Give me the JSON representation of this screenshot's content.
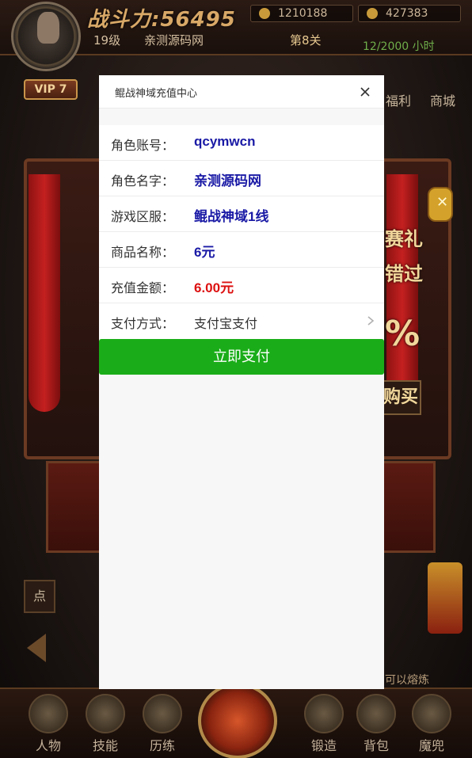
{
  "game": {
    "power": "战斗力:56495",
    "level": "19级",
    "server_name": "亲测源码网",
    "stage": "第8关",
    "currency_a": "1210188",
    "currency_b": "427383",
    "timer": "12/2000 小时",
    "vip": "VIP 7",
    "side_fuli": "福利",
    "side_shop": "商城",
    "promo_line1": "赛礼",
    "promo_line2": "错过",
    "promo_percent": "%",
    "buy_label": "购买",
    "dian_label": "点",
    "fuse_text": "可以熔炼",
    "nav": [
      {
        "label": "人物",
        "icon": "character-icon"
      },
      {
        "label": "技能",
        "icon": "skill-icon"
      },
      {
        "label": "历练",
        "icon": "training-icon"
      },
      {
        "label": "锻造",
        "icon": "forge-icon"
      },
      {
        "label": "背包",
        "icon": "bag-icon"
      },
      {
        "label": "魔兜",
        "icon": "mo-icon"
      }
    ]
  },
  "modal": {
    "title": "鲲战神域充值中心",
    "close_icon": "close-icon",
    "rows": [
      {
        "label": "角色账号：",
        "value": "qcymwcn"
      },
      {
        "label": "角色名字：",
        "value": "亲测源码网"
      },
      {
        "label": "游戏区服：",
        "value": "鲲战神域1线"
      },
      {
        "label": "商品名称：",
        "value": "6元"
      },
      {
        "label": "充值金额：",
        "value": "6.00元"
      },
      {
        "label": "支付方式：",
        "value": "支付宝支付"
      }
    ],
    "pay_button": "立即支付"
  },
  "colors": {
    "value_blue": "#1a1aa6",
    "amount_red": "#dd1111",
    "pay_green": "#1aad19"
  }
}
